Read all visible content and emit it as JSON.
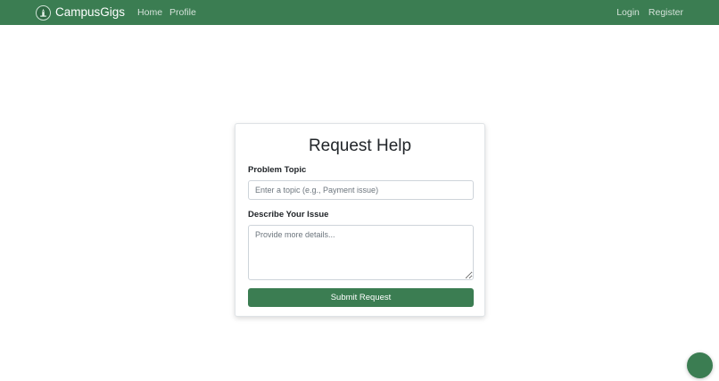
{
  "navbar": {
    "brand": "CampusGigs",
    "logo_icon": "campus-logo-icon",
    "left_links": [
      {
        "label": "Home"
      },
      {
        "label": "Profile"
      }
    ],
    "right_links": [
      {
        "label": "Login"
      },
      {
        "label": "Register"
      }
    ],
    "background_color": "#3b7d52"
  },
  "form": {
    "title": "Request Help",
    "topic_label": "Problem Topic",
    "topic_placeholder": "Enter a topic (e.g., Payment issue)",
    "topic_value": "",
    "description_label": "Describe Your Issue",
    "description_placeholder": "Provide more details...",
    "description_value": "",
    "submit_label": "Submit Request",
    "accent_color": "#3b7d52"
  },
  "floating_button": {
    "icon": "chat-bubble-icon",
    "color": "#3b7d52"
  }
}
